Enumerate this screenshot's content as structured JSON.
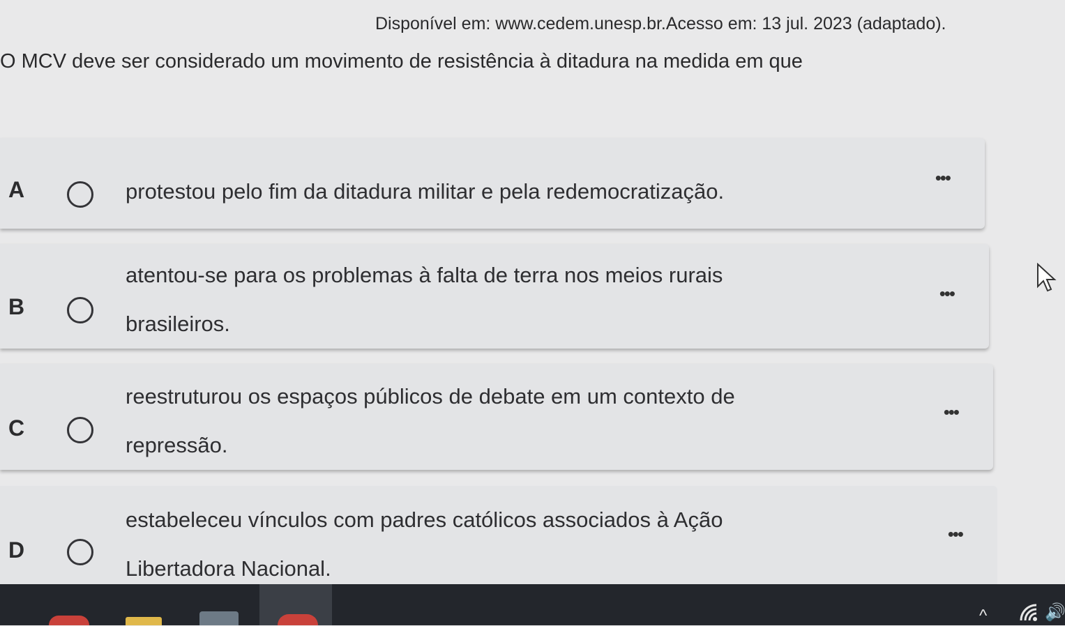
{
  "source_text": "Disponível em: www.cedem.unesp.br.Acesso em: 13 jul. 2023 (adaptado).",
  "question_text": "O MCV deve ser considerado um movimento de resistência à ditadura na medida em que",
  "options": [
    {
      "letter": "A",
      "lines": [
        "protestou pelo fim da ditadura militar e pela redemocratização."
      ],
      "more": "•••"
    },
    {
      "letter": "B",
      "lines": [
        "atentou-se para os problemas à falta de terra nos meios rurais",
        "brasileiros."
      ],
      "more": "•••"
    },
    {
      "letter": "C",
      "lines": [
        "reestruturou os espaços públicos de debate em um contexto de",
        "repressão."
      ],
      "more": "•••"
    },
    {
      "letter": "D",
      "lines": [
        "estabeleceu vínculos com padres católicos associados à Ação",
        "Libertadora Nacional."
      ],
      "more": "•••"
    }
  ],
  "taskbar": {
    "tray_chevron": "^",
    "tray_speaker": "🔊"
  }
}
